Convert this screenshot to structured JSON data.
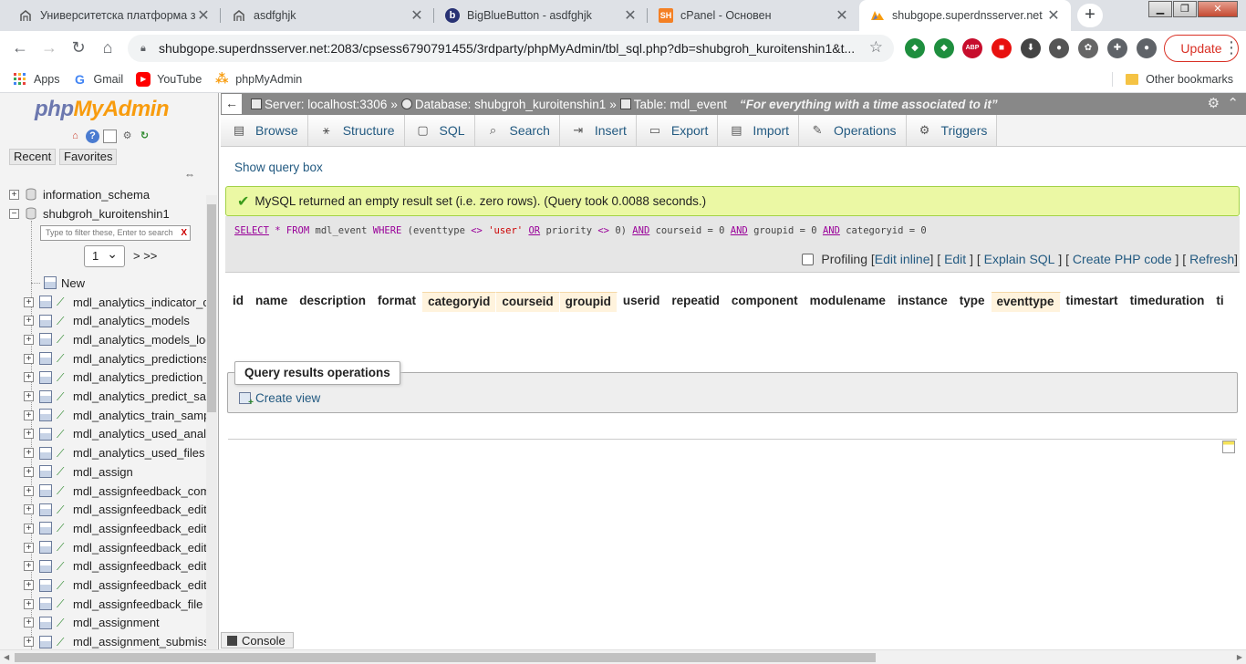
{
  "browser": {
    "tabs": [
      {
        "title": "Университетска платформа за",
        "favicon": "moodle-icon"
      },
      {
        "title": "asdfghjk",
        "favicon": "moodle-icon"
      },
      {
        "title": "BigBlueButton - asdfghjk",
        "favicon": "bigbluebutton-icon"
      },
      {
        "title": "cPanel - Основен",
        "favicon": "cpanel-icon",
        "favicon_text": "SH"
      },
      {
        "title": "shubgope.superdnsserver.net /",
        "favicon": "phpmyadmin-icon"
      }
    ],
    "new_tab_symbol": "+",
    "close_symbol": "✕",
    "url": "shubgope.superdnsserver.net:2083/cpsess6790791455/3rdparty/phpMyAdmin/tbl_sql.php?db=shubgroh_kuroitenshin1&t...",
    "extensions": [
      {
        "name": "shield-extension-icon",
        "color": "#1e8e3e",
        "label": "◆"
      },
      {
        "name": "shield2-extension-icon",
        "color": "#1e8e3e",
        "label": "◆"
      },
      {
        "name": "adblock-plus-icon",
        "color": "#c70d2c",
        "label": "ABP"
      },
      {
        "name": "stop-extension-icon",
        "color": "#e8110f",
        "label": "■"
      },
      {
        "name": "download-extension-icon",
        "color": "#444444",
        "label": "⬇"
      },
      {
        "name": "extension-icon-1",
        "color": "#555555",
        "label": "●"
      },
      {
        "name": "extension-icon-2",
        "color": "#666666",
        "label": "✿"
      },
      {
        "name": "puzzle-icon",
        "color": "#5f6368",
        "label": "✚"
      },
      {
        "name": "profile-icon",
        "color": "#5f6368",
        "label": "●"
      }
    ],
    "update_label": "Update",
    "bookmarks": [
      {
        "label": "Apps",
        "icon": "apps-grid-icon"
      },
      {
        "label": "Gmail",
        "icon": "google-icon",
        "icon_text": "G"
      },
      {
        "label": "YouTube",
        "icon": "youtube-icon",
        "icon_text": "▶"
      },
      {
        "label": "phpMyAdmin",
        "icon": "phpmyadmin-icon",
        "icon_text": "⁂"
      }
    ],
    "other_bookmarks": "Other bookmarks"
  },
  "pma": {
    "logo_php": "php",
    "logo_my_admin": "MyAdmin",
    "recent_label": "Recent",
    "favorites_label": "Favorites",
    "link_symbol": "⇔",
    "databases": [
      {
        "name": "information_schema",
        "expander": "+"
      },
      {
        "name": "shubgroh_kuroitenshin1",
        "expander": "−"
      }
    ],
    "filter_placeholder": "Type to filter these, Enter to search",
    "filter_clear": "X",
    "page_select": "1",
    "next_pages": "> >>",
    "new_label": "New",
    "tables": [
      "mdl_analytics_indicator_ca",
      "mdl_analytics_models",
      "mdl_analytics_models_log",
      "mdl_analytics_predictions",
      "mdl_analytics_prediction_a",
      "mdl_analytics_predict_sam",
      "mdl_analytics_train_sampl",
      "mdl_analytics_used_analys",
      "mdl_analytics_used_files",
      "mdl_assign",
      "mdl_assignfeedback_comr",
      "mdl_assignfeedback_editp",
      "mdl_assignfeedback_editp",
      "mdl_assignfeedback_editp",
      "mdl_assignfeedback_editp",
      "mdl_assignfeedback_editp",
      "mdl_assignfeedback_file",
      "mdl_assignment",
      "mdl_assignment_submissi"
    ],
    "breadcrumb": {
      "server": "Server: localhost:3306",
      "sep1": "»",
      "database": "Database: shubgroh_kuroitenshin1",
      "sep2": "»",
      "table": "Table: mdl_event",
      "comment": "“For everything with a time associated to it”"
    },
    "menu_tabs": [
      {
        "label": "Browse",
        "icon": "browse-icon",
        "glyph": "▤"
      },
      {
        "label": "Structure",
        "icon": "structure-icon",
        "glyph": "⚹"
      },
      {
        "label": "SQL",
        "icon": "sql-icon",
        "glyph": "▢"
      },
      {
        "label": "Search",
        "icon": "search-icon",
        "glyph": "⌕"
      },
      {
        "label": "Insert",
        "icon": "insert-icon",
        "glyph": "⇥"
      },
      {
        "label": "Export",
        "icon": "export-icon",
        "glyph": "▭"
      },
      {
        "label": "Import",
        "icon": "import-icon",
        "glyph": "▤"
      },
      {
        "label": "Operations",
        "icon": "wrench-icon",
        "glyph": "✎"
      },
      {
        "label": "Triggers",
        "icon": "triggers-icon",
        "glyph": "⚙"
      }
    ],
    "show_query_box": "Show query box",
    "success_message": "MySQL returned an empty result set (i.e. zero rows). (Query took 0.0088 seconds.)",
    "sql": {
      "select": "SELECT",
      "star": " * ",
      "from": "FROM",
      "p1": " mdl_event ",
      "where": "WHERE",
      "p2": " (eventtype ",
      "ne1": "<>",
      "p3": " ",
      "user": "'user'",
      "p4": " ",
      "or": "OR",
      "p5": " priority ",
      "ne2": "<>",
      "p6": " 0) ",
      "and1": "AND",
      "p7": " courseid = 0 ",
      "and2": "AND",
      "p8": " groupid = 0 ",
      "and3": "AND",
      "p9": " categoryid = 0"
    },
    "profiling_label": "Profiling",
    "links": {
      "edit_inline": "Edit inline",
      "edit": "Edit",
      "explain": "Explain SQL",
      "php": "Create PHP code",
      "refresh": "Refresh"
    },
    "columns": [
      {
        "name": "id",
        "highlight": false
      },
      {
        "name": "name",
        "highlight": false
      },
      {
        "name": "description",
        "highlight": false
      },
      {
        "name": "format",
        "highlight": false
      },
      {
        "name": "categoryid",
        "highlight": true
      },
      {
        "name": "courseid",
        "highlight": true
      },
      {
        "name": "groupid",
        "highlight": true
      },
      {
        "name": "userid",
        "highlight": false
      },
      {
        "name": "repeatid",
        "highlight": false
      },
      {
        "name": "component",
        "highlight": false
      },
      {
        "name": "modulename",
        "highlight": false
      },
      {
        "name": "instance",
        "highlight": false
      },
      {
        "name": "type",
        "highlight": false
      },
      {
        "name": "eventtype",
        "highlight": true
      },
      {
        "name": "timestart",
        "highlight": false
      },
      {
        "name": "timeduration",
        "highlight": false
      },
      {
        "name": "ti",
        "highlight": false
      }
    ],
    "query_ops_title": "Query results operations",
    "create_view": "Create view",
    "console_label": "Console"
  }
}
